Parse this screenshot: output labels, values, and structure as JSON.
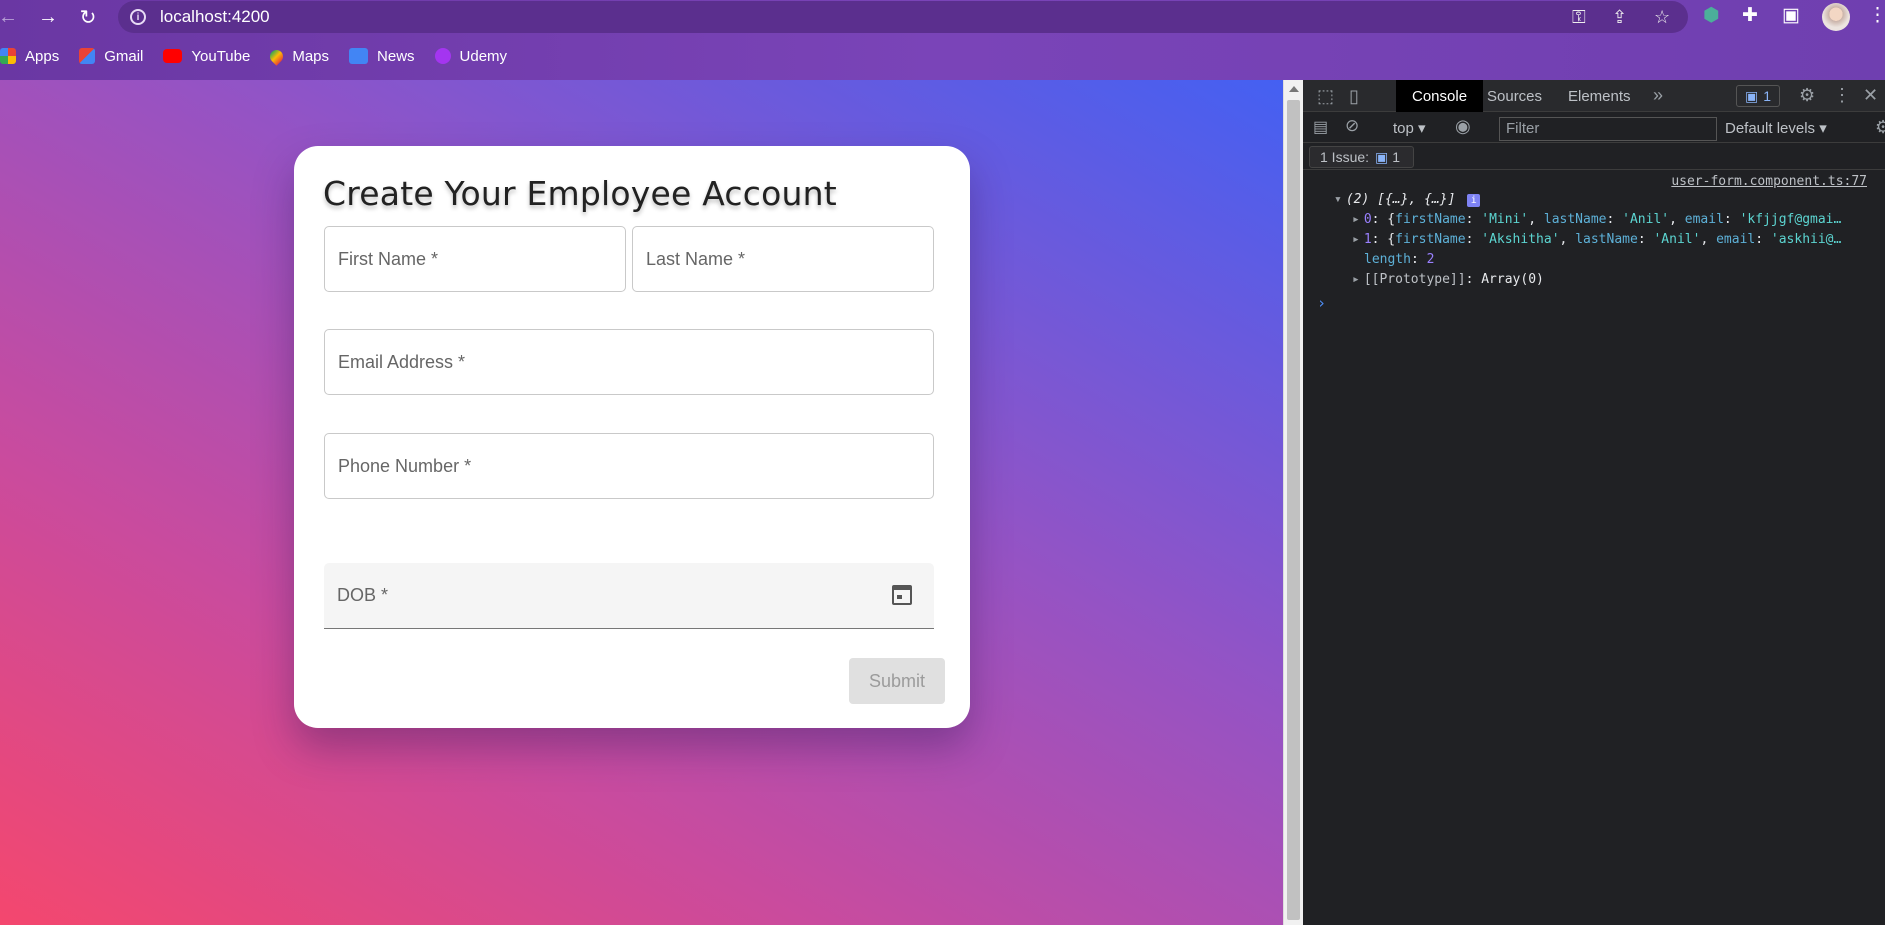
{
  "browser": {
    "url": "localhost:4200",
    "bookmarks": [
      {
        "label": "Apps",
        "icon": "apps-grid-icon",
        "color": "#ea4335"
      },
      {
        "label": "Gmail",
        "icon": "gmail-icon",
        "color": "#ea4335"
      },
      {
        "label": "YouTube",
        "icon": "youtube-icon",
        "color": "#ff0000"
      },
      {
        "label": "Maps",
        "icon": "maps-icon",
        "color": "#34a853"
      },
      {
        "label": "News",
        "icon": "news-icon",
        "color": "#4285f4"
      },
      {
        "label": "Udemy",
        "icon": "udemy-icon",
        "color": "#a435f0"
      }
    ]
  },
  "form": {
    "title": "Create Your Employee Account",
    "first_name_label": "First Name *",
    "last_name_label": "Last Name *",
    "email_label": "Email Address *",
    "phone_label": "Phone Number *",
    "dob_label": "DOB *",
    "submit_label": "Submit"
  },
  "devtools": {
    "tabs": [
      "Console",
      "Sources",
      "Elements"
    ],
    "active_tab": "Console",
    "issues_badge": "1",
    "context": "top",
    "filter_placeholder": "Filter",
    "levels": "Default levels",
    "issues_text": "1 Issue:",
    "issues_count": "1",
    "source_link": "user-form.component.ts:77",
    "log_summary": "(2) [{…}, {…}]",
    "entries": [
      {
        "index": "0",
        "firstName": "'Mini'",
        "lastName": "'Anil'",
        "email": "'kfjjgf@gmai…"
      },
      {
        "index": "1",
        "firstName": "'Akshitha'",
        "lastName": "'Anil'",
        "email": "'askhii@…"
      }
    ],
    "length_key": "length",
    "length_value": "2",
    "prototype_key": "[[Prototype]]",
    "prototype_value": "Array(0)"
  }
}
